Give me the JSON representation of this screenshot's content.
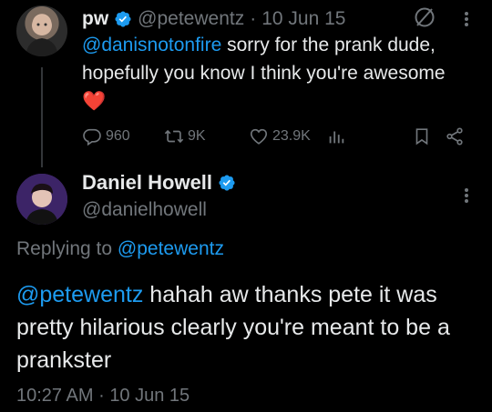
{
  "parent_tweet": {
    "name": "pw",
    "handle": "@petewentz",
    "separator": "·",
    "date": "10 Jun 15",
    "mention": "@danisnotonfire",
    "text": " sorry for the prank dude, hopefully you know I think you're awesome",
    "emoji": "❤️",
    "replies": "960",
    "retweets": "9K",
    "likes": "23.9K"
  },
  "reply_tweet": {
    "name": "Daniel Howell",
    "handle": "@danielhowell",
    "replying_prefix": "Replying to ",
    "replying_to": "@petewentz",
    "mention": "@petewentz",
    "text": " hahah aw thanks pete it was pretty hilarious clearly you're meant to be a prankster",
    "time": "10:27 AM",
    "separator": "·",
    "date": "10 Jun 15"
  },
  "colors": {
    "background": "#000000",
    "text": "#e7e9ea",
    "muted": "#71767b",
    "accent": "#1d9bf0",
    "heart": "#f91880"
  },
  "icons": {
    "verified": "verified-badge-icon",
    "no_circle": "no-circle-icon",
    "more": "more-vertical-icon",
    "reply": "reply-icon",
    "retweet": "retweet-icon",
    "like": "heart-icon",
    "views": "analytics-icon",
    "bookmark": "bookmark-icon",
    "share": "share-icon"
  }
}
